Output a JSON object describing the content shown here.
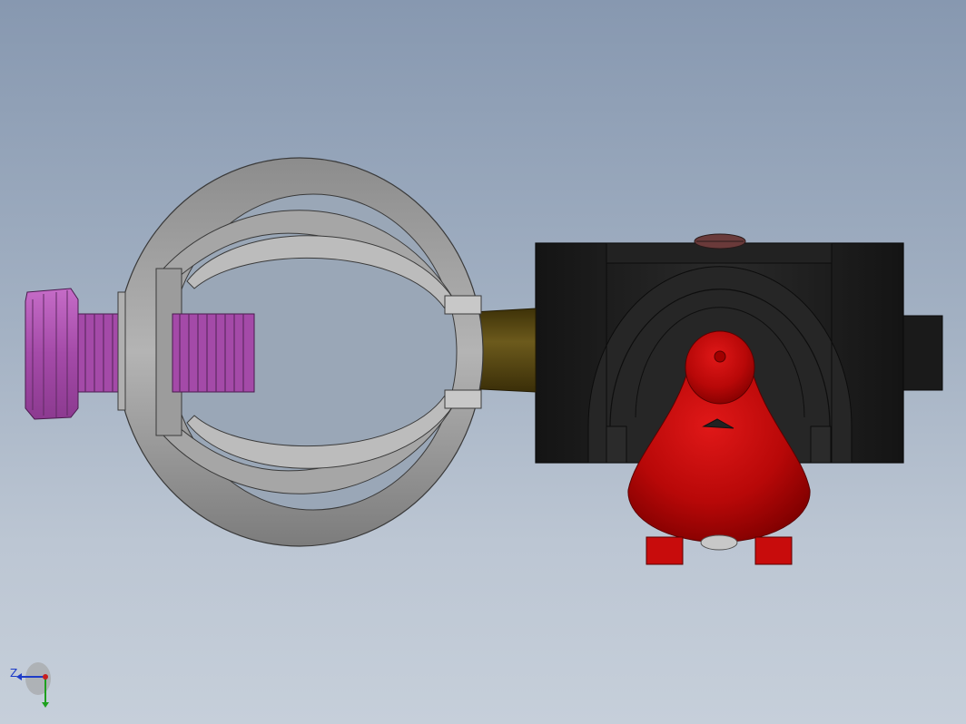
{
  "viewport": {
    "background_top": "#8798b0",
    "background_bottom": "#c6cfda"
  },
  "model": {
    "parts": [
      {
        "name": "thumb-screw",
        "color": "#b35bb5"
      },
      {
        "name": "ring-clamp",
        "color": "#9a9a9a"
      },
      {
        "name": "gold-rod",
        "color": "#5b4a14"
      },
      {
        "name": "black-housing",
        "color": "#1e1e1e"
      },
      {
        "name": "red-cone-cap",
        "color": "#c80c0c"
      }
    ]
  },
  "triad": {
    "z_label": "Z",
    "x_color": "#c81e1e",
    "y_color": "#1ea01e",
    "z_color": "#1e3cc8"
  }
}
